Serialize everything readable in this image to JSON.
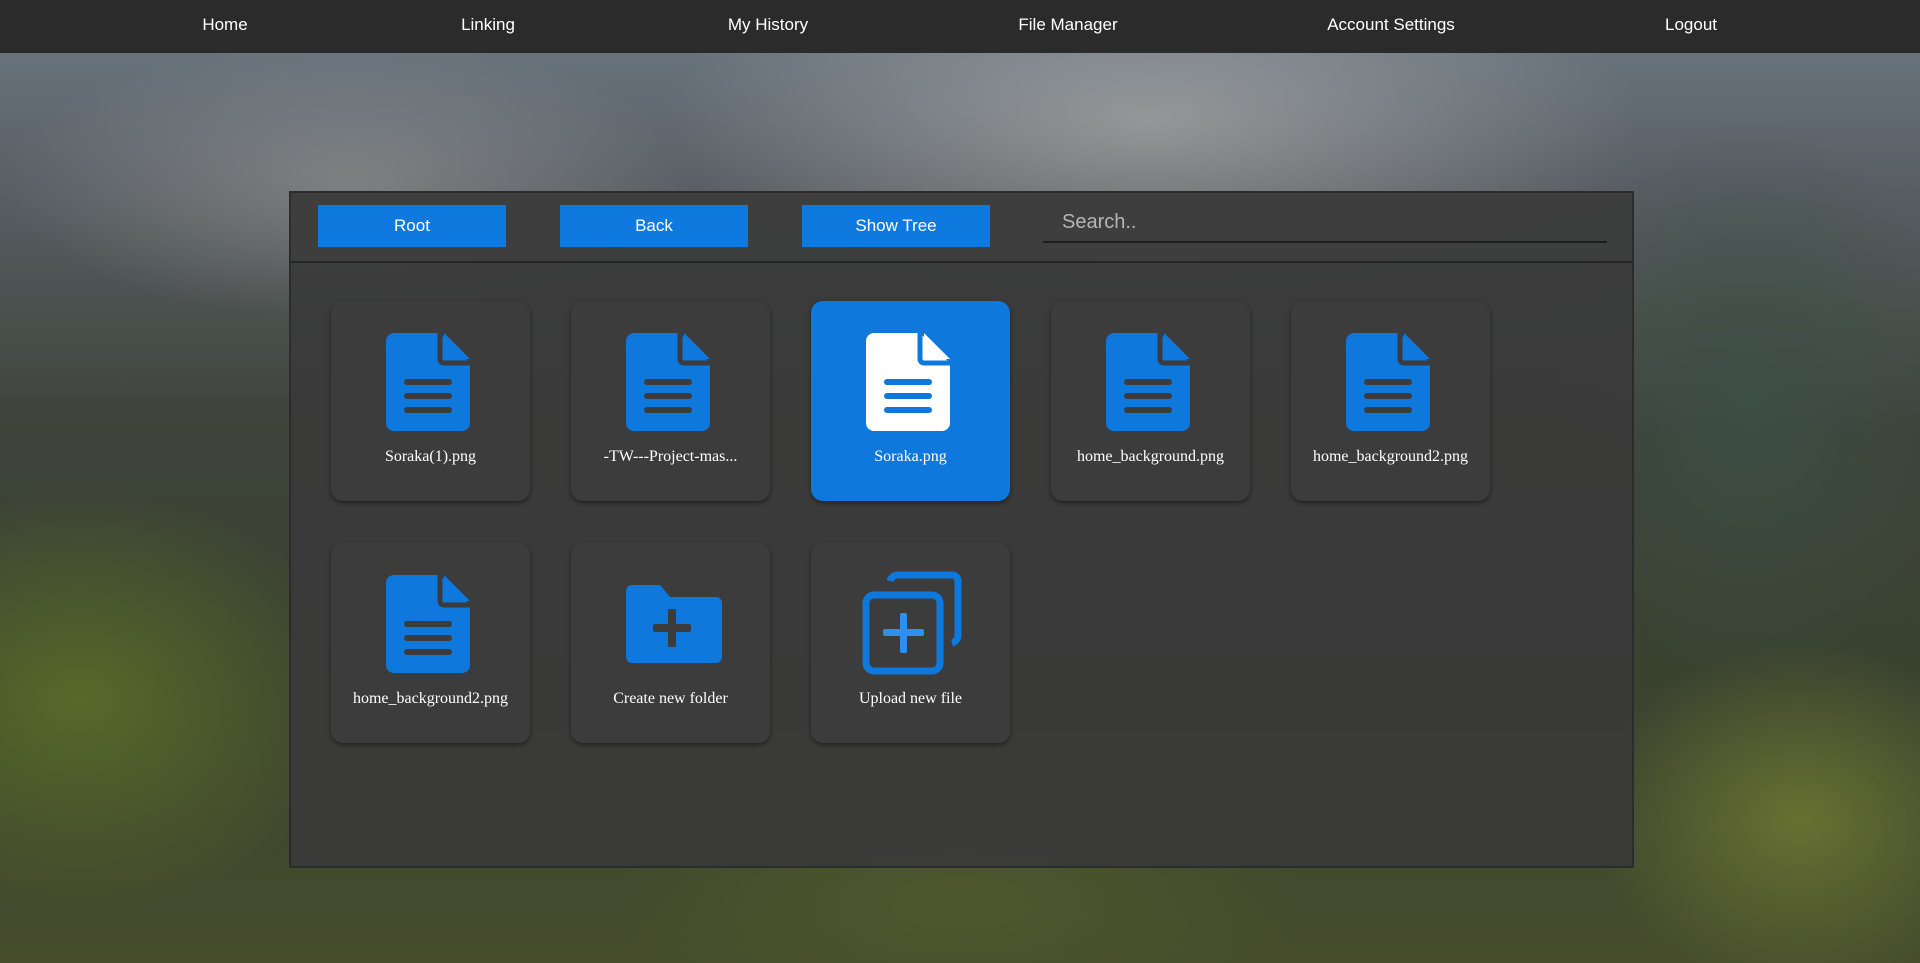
{
  "nav": {
    "home": "Home",
    "linking": "Linking",
    "history": "My History",
    "file_manager": "File Manager",
    "account_settings": "Account Settings",
    "logout": "Logout"
  },
  "toolbar": {
    "root_label": "Root",
    "back_label": "Back",
    "show_tree_label": "Show Tree",
    "search_placeholder": "Search..",
    "search_value": ""
  },
  "files": [
    {
      "name": "Soraka(1).png",
      "icon": "file-icon",
      "selected": false
    },
    {
      "name": "-TW---Project-mas...",
      "icon": "file-icon",
      "selected": false
    },
    {
      "name": "Soraka.png",
      "icon": "file-icon",
      "selected": true
    },
    {
      "name": "home_background.png",
      "icon": "file-icon",
      "selected": false
    },
    {
      "name": "home_background2.png",
      "icon": "file-icon",
      "selected": false
    },
    {
      "name": "home_background2.png",
      "icon": "file-icon",
      "selected": false
    }
  ],
  "actions": {
    "create_folder_label": "Create new folder",
    "create_folder_icon": "folder-plus-icon",
    "upload_file_label": "Upload new file",
    "upload_file_icon": "upload-file-icon"
  },
  "colors": {
    "accent": "#0e7ae0",
    "tile_bg": "#3c3c3c",
    "topbar_bg": "#2b2b2b"
  }
}
